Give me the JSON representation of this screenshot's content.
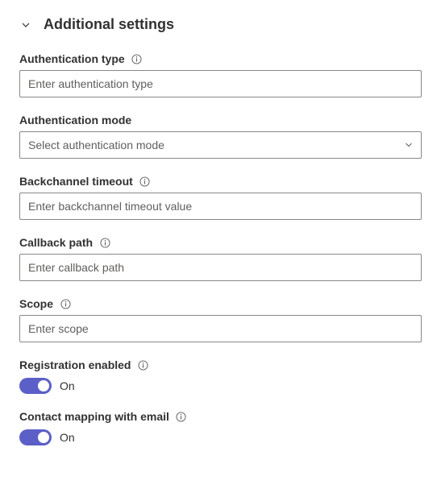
{
  "section": {
    "title": "Additional settings"
  },
  "fields": {
    "auth_type": {
      "label": "Authentication type",
      "placeholder": "Enter authentication type"
    },
    "auth_mode": {
      "label": "Authentication mode",
      "placeholder": "Select authentication mode"
    },
    "backchannel_timeout": {
      "label": "Backchannel timeout",
      "placeholder": "Enter backchannel timeout value"
    },
    "callback_path": {
      "label": "Callback path",
      "placeholder": "Enter callback path"
    },
    "scope": {
      "label": "Scope",
      "placeholder": "Enter scope"
    },
    "registration_enabled": {
      "label": "Registration enabled",
      "toggle_state": "On"
    },
    "contact_mapping": {
      "label": "Contact mapping with email",
      "toggle_state": "On"
    }
  }
}
